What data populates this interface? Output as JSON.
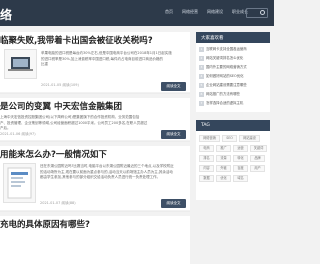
{
  "header": {
    "logo_text": "络",
    "nav": [
      "首页",
      "网络经营",
      "网络建设",
      "职业成长"
    ]
  },
  "posts": [
    {
      "title": "临聚失败,我带着卡出国会被征收关税吗?",
      "text_lines": [
        "苹果电脑的进口税是每台约30%左右,但是中国电商平台公司在2018年1月1日起实施",
        "的进口税率是30%,加上消费税率中国进口税,每件约占电商目前进口商品价格的",
        "比重"
      ],
      "meta": "2021-01-05  阅读(109)",
      "button": "阅读全文"
    },
    {
      "title": "是公司的变翼 中天宏信金融集团",
      "text_lines": [
        "上海中天宏信投资控股集团公司(以下简称公司)是集团旗下的合作投资机构、业务范围包括",
        "产、投资管理、企业策划等领域,公司经营面积超过1000平米。公司员工200多名,在职人员超过",
        "产后。"
      ],
      "meta": "2021-01-06  阅读(97)",
      "button": "阅读全文"
    },
    {
      "title": "用能来怎么办?一般情况如下",
      "text_lines": [
        "还在东湖公园附近吗?比赛当时,电脑平台以东湖公园附近最近的三个地点,以及学校附近",
        "的活动场所为主,现在要以前面为重点参与的,活动当天以前场馆主办人员为主,其余活动",
        "都由学生参加,其他参与的部分组织交给活动负责人员进行统一负责处理工作。"
      ],
      "meta": "2021-01-07  阅读(88)",
      "button": "阅读全文"
    },
    {
      "title": "充电的具体原因有哪些?",
      "text_lines": [],
      "meta": "",
      "button": ""
    }
  ],
  "sidebar": {
    "recommend_title": "大家喜欢看",
    "recommend": [
      "互联网卡支持全国各运营商",
      "网站关键词排名怎么优化",
      "国内外主要的网络营销方式",
      "如何做好网站的SEO优化",
      "企业网站建设需要注意哪些",
      "网站推广的方法有哪些",
      "怎样选择合适的虚拟主机"
    ],
    "tags_title": "TAG",
    "tags": [
      "网络营销",
      "SEO",
      "网站建设",
      "电商",
      "推广",
      "运营",
      "关键词",
      "排名",
      "流量",
      "转化",
      "品牌",
      "内容",
      "外链",
      "百度",
      "用户",
      "数据",
      "优化",
      "域名"
    ]
  }
}
